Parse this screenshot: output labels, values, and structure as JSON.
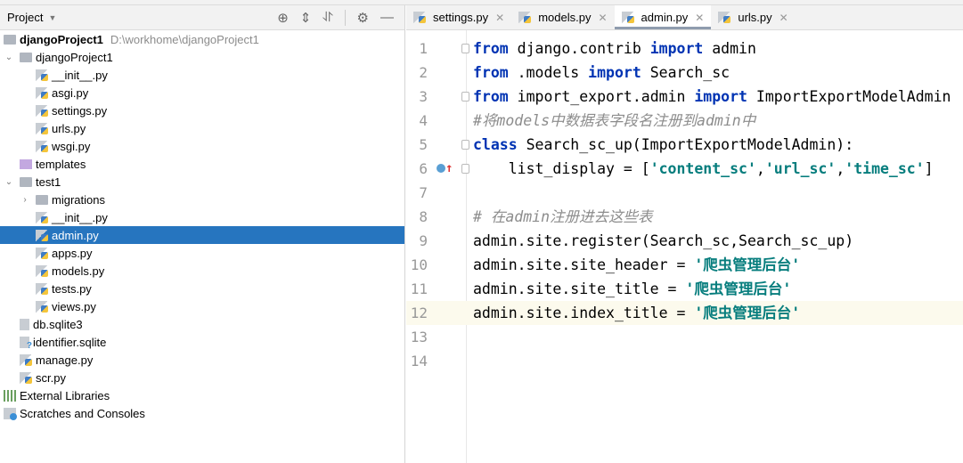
{
  "project_panel": {
    "title": "Project",
    "toolbar_icons": [
      "locate-icon",
      "expand-all-icon",
      "collapse-all-icon",
      "gear-icon",
      "minimize-icon"
    ],
    "tree": [
      {
        "label": "djangoProject1",
        "path": "D:\\workhome\\djangoProject1",
        "level": 0,
        "type": "folder",
        "bold": true
      },
      {
        "label": "djangoProject1",
        "level": 1,
        "type": "folder",
        "expanded": true
      },
      {
        "label": "__init__.py",
        "level": 2,
        "type": "py"
      },
      {
        "label": "asgi.py",
        "level": 2,
        "type": "py"
      },
      {
        "label": "settings.py",
        "level": 2,
        "type": "py"
      },
      {
        "label": "urls.py",
        "level": 2,
        "type": "py"
      },
      {
        "label": "wsgi.py",
        "level": 2,
        "type": "py"
      },
      {
        "label": "templates",
        "level": 1,
        "type": "tfolder"
      },
      {
        "label": "test1",
        "level": 1,
        "type": "folder",
        "expanded": true
      },
      {
        "label": "migrations",
        "level": 2,
        "type": "folder",
        "expanded": false
      },
      {
        "label": "__init__.py",
        "level": 2,
        "type": "py"
      },
      {
        "label": "admin.py",
        "level": 2,
        "type": "py",
        "selected": true
      },
      {
        "label": "apps.py",
        "level": 2,
        "type": "py"
      },
      {
        "label": "models.py",
        "level": 2,
        "type": "py"
      },
      {
        "label": "tests.py",
        "level": 2,
        "type": "py"
      },
      {
        "label": "views.py",
        "level": 2,
        "type": "py"
      },
      {
        "label": "db.sqlite3",
        "level": 1,
        "type": "file"
      },
      {
        "label": "identifier.sqlite",
        "level": 1,
        "type": "unk"
      },
      {
        "label": "manage.py",
        "level": 1,
        "type": "py"
      },
      {
        "label": "scr.py",
        "level": 1,
        "type": "py"
      },
      {
        "label": "External Libraries",
        "level": 0,
        "type": "lib"
      },
      {
        "label": "Scratches and Consoles",
        "level": 0,
        "type": "scr"
      }
    ]
  },
  "tabs": [
    {
      "label": "settings.py",
      "active": false
    },
    {
      "label": "models.py",
      "active": false
    },
    {
      "label": "admin.py",
      "active": true
    },
    {
      "label": "urls.py",
      "active": false
    }
  ],
  "colors": {
    "selection": "#2675bf",
    "keyword": "#0033b3",
    "string": "#067d7d",
    "comment": "#8c8c8c",
    "current_line": "#fcfaed"
  },
  "editor": {
    "current_line": 12,
    "lines": [
      [
        [
          "from",
          "kw"
        ],
        [
          " django.contrib ",
          ""
        ],
        [
          "import",
          "kw"
        ],
        [
          " admin",
          ""
        ]
      ],
      [
        [
          "from",
          "kw"
        ],
        [
          " .models ",
          ""
        ],
        [
          "import",
          "kw"
        ],
        [
          " Search_sc",
          ""
        ]
      ],
      [
        [
          "from",
          "kw"
        ],
        [
          " import_export.admin ",
          ""
        ],
        [
          "import",
          "kw"
        ],
        [
          " ImportExportModelAdmin",
          ""
        ]
      ],
      [
        [
          "#将models中数据表字段名注册到admin中",
          "cm"
        ]
      ],
      [
        [
          "class",
          "kw"
        ],
        [
          " Search_sc_up(ImportExportModelAdmin):",
          ""
        ]
      ],
      [
        [
          "    list_display = [",
          ""
        ],
        [
          "'content_sc'",
          "str"
        ],
        [
          ",",
          ""
        ],
        [
          "'url_sc'",
          "str"
        ],
        [
          ",",
          ""
        ],
        [
          "'time_sc'",
          "str"
        ],
        [
          "]",
          ""
        ]
      ],
      [],
      [
        [
          "# 在admin注册进去这些表",
          "cm"
        ]
      ],
      [
        [
          "admin.site.register(Search_sc,Search_sc_up)",
          ""
        ]
      ],
      [
        [
          "admin.site.site_header = ",
          ""
        ],
        [
          "'爬虫管理后台'",
          "str"
        ]
      ],
      [
        [
          "admin.site.site_title = ",
          ""
        ],
        [
          "'爬虫管理后台'",
          "str"
        ]
      ],
      [
        [
          "admin.site.index_title = ",
          ""
        ],
        [
          "'爬虫管理后台'",
          "str"
        ]
      ],
      [],
      []
    ]
  }
}
